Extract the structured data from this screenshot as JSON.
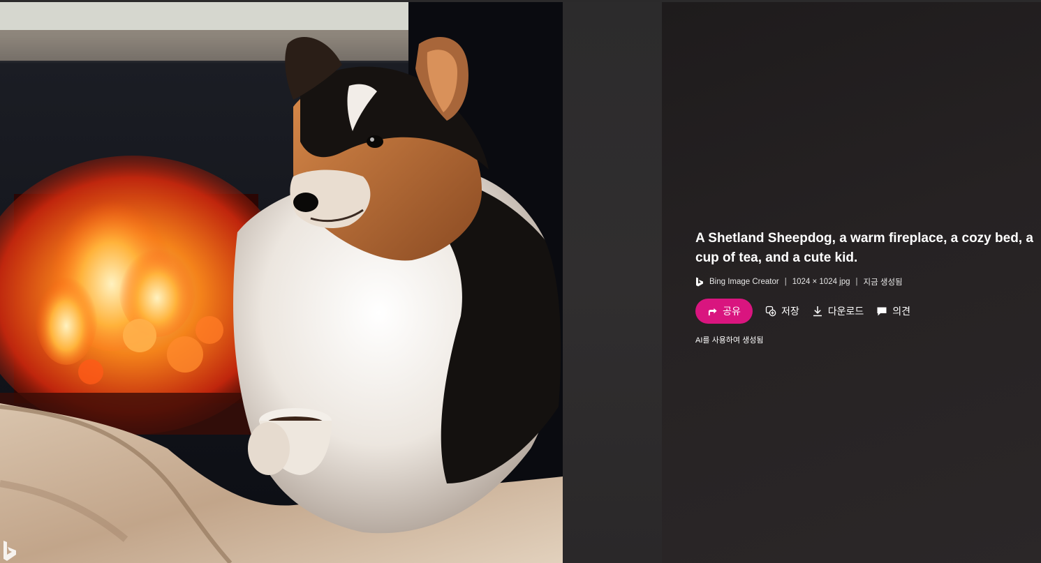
{
  "image": {
    "alt": "A Shetland Sheepdog, a warm fireplace, a cozy bed, a cup of tea, and a cute kid.",
    "watermark_icon": "bing-logo-icon"
  },
  "details": {
    "title": "A Shetland Sheepdog, a warm fireplace, a cozy bed, a cup of tea, and a cute kid.",
    "meta": {
      "creator_icon": "bing-logo-icon",
      "creator": "Bing Image Creator",
      "separator": "|",
      "dimensions": "1024 × 1024 jpg",
      "created": "지금 생성됨"
    },
    "actions": {
      "share_label": "공유",
      "share_icon": "share-icon",
      "save_label": "저장",
      "save_icon": "collection-add-icon",
      "download_label": "다운로드",
      "download_icon": "download-icon",
      "feedback_label": "의견",
      "feedback_icon": "comment-icon"
    },
    "ai_note": "AI를 사용하여 생성됨"
  },
  "colors": {
    "accent": "#d9157f",
    "panel_bg": "#231f20",
    "text": "#ffffff"
  }
}
